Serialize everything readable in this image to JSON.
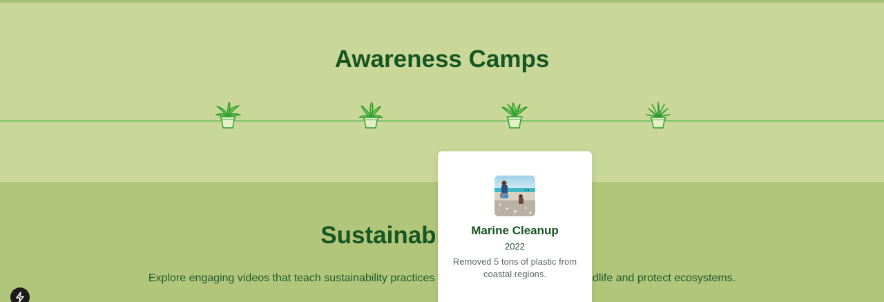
{
  "camps": {
    "title": "Awareness Camps",
    "plants": [
      {
        "icon": "potted-plant-icon"
      },
      {
        "icon": "potted-plant-icon"
      },
      {
        "icon": "potted-plant-icon"
      },
      {
        "icon": "potted-plant-icon"
      }
    ]
  },
  "sustainability": {
    "title": "Sustainability Videos",
    "description": "Explore engaging videos that teach sustainability practices and inspire action to support wildlife and protect ecosystems."
  },
  "popup": {
    "title": "Marine Cleanup",
    "year": "2022",
    "description": "Removed 5 tons of plastic from coastal regions.",
    "image": "beach-cleanup-photo"
  },
  "floating_button": {
    "icon": "lightning-bolt-icon"
  },
  "colors": {
    "camps_background": "#c9d898",
    "sustain_background": "#b1c67b",
    "heading": "#175522",
    "timeline": "#7fc46a",
    "plant": "#2e9b2e"
  }
}
